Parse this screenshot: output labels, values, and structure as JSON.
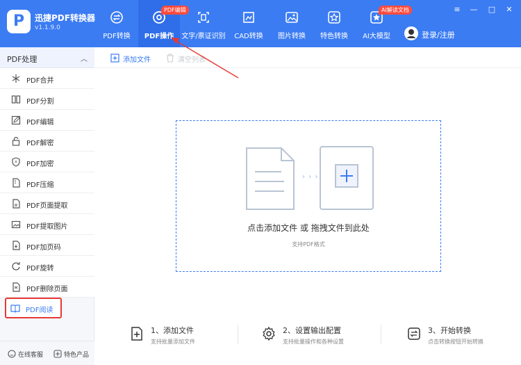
{
  "app": {
    "name": "迅捷PDF转换器",
    "version": "v1.1.9.0",
    "logo_letter": "P"
  },
  "nav": [
    {
      "label": "PDF转换",
      "icon": "swap-icon"
    },
    {
      "label": "PDF操作",
      "icon": "pdf-gear-icon",
      "badge": "PDF编辑"
    },
    {
      "label": "文字/票证识别",
      "icon": "scan-icon"
    },
    {
      "label": "CAD转换",
      "icon": "cad-icon"
    },
    {
      "label": "图片转换",
      "icon": "image-icon"
    },
    {
      "label": "特色转换",
      "icon": "star-icon"
    },
    {
      "label": "AI大模型",
      "icon": "ai-icon",
      "badge": "AI解读文档"
    }
  ],
  "login_label": "登录/注册",
  "window_controls": {
    "menu": "≡",
    "minimize": "—",
    "maximize": "□",
    "close": "✕"
  },
  "sidebar": {
    "title": "PDF处理",
    "items": [
      {
        "label": "PDF合并",
        "icon": "merge-icon"
      },
      {
        "label": "PDF分割",
        "icon": "split-icon"
      },
      {
        "label": "PDF编辑",
        "icon": "edit-icon"
      },
      {
        "label": "PDF解密",
        "icon": "unlock-icon"
      },
      {
        "label": "PDF加密",
        "icon": "shield-icon"
      },
      {
        "label": "PDF压缩",
        "icon": "compress-icon"
      },
      {
        "label": "PDF页面提取",
        "icon": "page-extract-icon"
      },
      {
        "label": "PDF提取图片",
        "icon": "image-extract-icon"
      },
      {
        "label": "PDF加页码",
        "icon": "page-number-icon"
      },
      {
        "label": "PDF旋转",
        "icon": "rotate-icon"
      },
      {
        "label": "PDF删除页面",
        "icon": "delete-page-icon"
      },
      {
        "label": "PDF阅读",
        "icon": "book-icon"
      }
    ],
    "bottom": {
      "service": "在线客服",
      "featured": "特色产品"
    }
  },
  "toolbar": {
    "add_file": "添加文件",
    "clear_list": "清空列表"
  },
  "dropzone": {
    "main": "点击添加文件 或 拖拽文件到此处",
    "sub": "支持PDF格式",
    "dots": "› › ›"
  },
  "steps": [
    {
      "title": "1、添加文件",
      "sub": "支持批量添加文件",
      "icon": "add-file-icon"
    },
    {
      "title": "2、设置输出配置",
      "sub": "支持批量操作和各种设置",
      "icon": "settings-icon"
    },
    {
      "title": "3、开始转换",
      "sub": "点击转换按钮开始转换",
      "icon": "convert-icon"
    }
  ],
  "colors": {
    "brand": "#3b7cf3",
    "badge": "#ff4b3e",
    "highlight": "#e53935"
  }
}
